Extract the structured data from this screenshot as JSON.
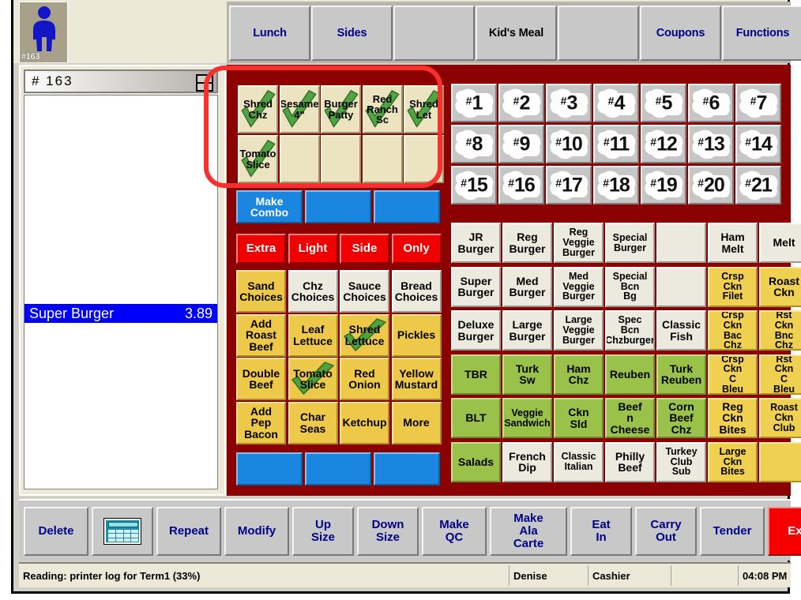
{
  "order": {
    "avatar_label": "#163",
    "avatar_icon": "person-icon",
    "header_value": "# 163",
    "menu_icon": "list-menu-icon",
    "items": [
      {
        "name": "Super Burger",
        "price": "3.89",
        "selected": true
      }
    ]
  },
  "categories": [
    {
      "label": "Lunch",
      "style": "blue"
    },
    {
      "label": "Sides",
      "style": "blue"
    },
    {
      "label": "",
      "style": "blue"
    },
    {
      "label": "Kid's Meal",
      "style": "dark"
    },
    {
      "label": "",
      "style": "blue"
    },
    {
      "label": "Coupons",
      "style": "blue"
    },
    {
      "label": "Functions",
      "style": "blue"
    }
  ],
  "modifier_tray": {
    "rows": [
      [
        {
          "label": "Shred Chz",
          "checked": true
        },
        {
          "label": "Sesame 4\"",
          "checked": true
        },
        {
          "label": "Burger Patty",
          "checked": true
        },
        {
          "label": "Red Ranch Sc",
          "checked": true
        },
        {
          "label": "Shred Let",
          "checked": true
        }
      ],
      [
        {
          "label": "Tomato Slice",
          "checked": true
        },
        {
          "label": "",
          "checked": false
        },
        {
          "label": "",
          "checked": false
        },
        {
          "label": "",
          "checked": false
        },
        {
          "label": "",
          "checked": false
        }
      ]
    ]
  },
  "combo_row": [
    {
      "label": "Make Combo"
    },
    {
      "label": ""
    },
    {
      "label": ""
    }
  ],
  "qualifiers": [
    {
      "label": "Extra"
    },
    {
      "label": "Light"
    },
    {
      "label": "Side"
    },
    {
      "label": "Only"
    }
  ],
  "modifier_grid": {
    "rows": [
      [
        {
          "label": "Sand Choices",
          "style": "gold",
          "checked": false
        },
        {
          "label": "Chz Choices",
          "style": "white",
          "checked": false
        },
        {
          "label": "Sauce Choices",
          "style": "white",
          "checked": false
        },
        {
          "label": "Bread Choices",
          "style": "white",
          "checked": false
        }
      ],
      [
        {
          "label": "Add Roast Beef",
          "style": "gold",
          "checked": false
        },
        {
          "label": "Leaf Lettuce",
          "style": "gold",
          "checked": false
        },
        {
          "label": "Shred Lettuce",
          "style": "gold",
          "checked": true
        },
        {
          "label": "Pickles",
          "style": "gold",
          "checked": false
        }
      ],
      [
        {
          "label": "Double Beef",
          "style": "gold",
          "checked": false
        },
        {
          "label": "Tomato Slice",
          "style": "gold",
          "checked": true
        },
        {
          "label": "Red Onion",
          "style": "gold",
          "checked": false
        },
        {
          "label": "Yellow Mustard",
          "style": "gold",
          "checked": false
        }
      ],
      [
        {
          "label": "Add Pep Bacon",
          "style": "gold",
          "checked": false
        },
        {
          "label": "Char Seas",
          "style": "gold",
          "checked": false
        },
        {
          "label": "Ketchup",
          "style": "gold",
          "checked": false
        },
        {
          "label": "More",
          "style": "gold",
          "checked": false
        }
      ]
    ]
  },
  "bottom_blue_row": [
    {
      "label": ""
    },
    {
      "label": ""
    },
    {
      "label": ""
    }
  ],
  "numpad": {
    "rows": [
      [
        "1",
        "2",
        "3",
        "4",
        "5",
        "6",
        "7"
      ],
      [
        "8",
        "9",
        "10",
        "11",
        "12",
        "13",
        "14"
      ],
      [
        "15",
        "16",
        "17",
        "18",
        "19",
        "20",
        "21"
      ]
    ],
    "prefix": "#"
  },
  "menu_grid": {
    "rows": [
      [
        {
          "label": "JR Burger",
          "style": "cream"
        },
        {
          "label": "Reg Burger",
          "style": "cream"
        },
        {
          "label": "Reg Veggie Burger",
          "style": "cream"
        },
        {
          "label": "Special Burger",
          "style": "cream"
        },
        {
          "label": "",
          "style": "cream"
        },
        {
          "label": "Ham Melt",
          "style": "cream"
        },
        {
          "label": "Melt",
          "style": "cream"
        }
      ],
      [
        {
          "label": "Super Burger",
          "style": "cream"
        },
        {
          "label": "Med Burger",
          "style": "cream"
        },
        {
          "label": "Med Veggie Burger",
          "style": "cream"
        },
        {
          "label": "Special Bcn Bg",
          "style": "cream"
        },
        {
          "label": "",
          "style": "cream"
        },
        {
          "label": "Crsp Ckn Filet",
          "style": "gold"
        },
        {
          "label": "Roast Ckn",
          "style": "gold"
        }
      ],
      [
        {
          "label": "Deluxe Burger",
          "style": "cream"
        },
        {
          "label": "Large Burger",
          "style": "cream"
        },
        {
          "label": "Large Veggie Burger",
          "style": "cream"
        },
        {
          "label": "Spec Bcn Chzburger",
          "style": "cream"
        },
        {
          "label": "Classic Fish",
          "style": "cream"
        },
        {
          "label": "Crsp Ckn Bac Chz",
          "style": "gold"
        },
        {
          "label": "Rst Ckn Bnc Chz",
          "style": "gold"
        }
      ],
      [
        {
          "label": "TBR",
          "style": "green"
        },
        {
          "label": "Turk Sw",
          "style": "green"
        },
        {
          "label": "Ham Chz",
          "style": "green"
        },
        {
          "label": "Reuben",
          "style": "green"
        },
        {
          "label": "Turk Reuben",
          "style": "green"
        },
        {
          "label": "Crsp Ckn C Bleu",
          "style": "gold"
        },
        {
          "label": "Rst Ckn C Bleu",
          "style": "gold"
        }
      ],
      [
        {
          "label": "BLT",
          "style": "green"
        },
        {
          "label": "Veggie Sandwich",
          "style": "green"
        },
        {
          "label": "Ckn Sld",
          "style": "green"
        },
        {
          "label": "Beef n Cheese",
          "style": "green"
        },
        {
          "label": "Corn Beef Chz",
          "style": "green"
        },
        {
          "label": "Reg Ckn Bites",
          "style": "gold"
        },
        {
          "label": "Roast Ckn Club",
          "style": "gold"
        }
      ],
      [
        {
          "label": "Salads",
          "style": "green"
        },
        {
          "label": "French Dip",
          "style": "cream"
        },
        {
          "label": "Classic Italian",
          "style": "cream"
        },
        {
          "label": "Philly Beef",
          "style": "cream"
        },
        {
          "label": "Turkey Club Sub",
          "style": "cream"
        },
        {
          "label": "Large Ckn Bites",
          "style": "gold"
        },
        {
          "label": "",
          "style": "gold"
        }
      ]
    ]
  },
  "toolbar": [
    {
      "label": "Delete",
      "kind": "text"
    },
    {
      "label": "",
      "kind": "keyboard-icon"
    },
    {
      "label": "Repeat",
      "kind": "text"
    },
    {
      "label": "Modify",
      "kind": "text"
    },
    {
      "label": "Up Size",
      "kind": "text"
    },
    {
      "label": "Down Size",
      "kind": "text"
    },
    {
      "label": "Make QC",
      "kind": "text"
    },
    {
      "label": "Make Ala Carte",
      "kind": "text"
    },
    {
      "label": "Eat In",
      "kind": "text"
    },
    {
      "label": "Carry Out",
      "kind": "text"
    },
    {
      "label": "Tender",
      "kind": "text"
    },
    {
      "label": "Exit",
      "kind": "exit"
    }
  ],
  "status_bar": {
    "message": "Reading: printer log for Term1 (33%)",
    "user": "Denise",
    "role": "Cashier",
    "spare": "",
    "time": "04:08 PM"
  },
  "colors": {
    "panel_red": "#8b0000",
    "annotation_red": "#f8312f",
    "accent_blue": "#00008b",
    "select_blue": "#0000ff",
    "exit_red": "#f60000"
  }
}
